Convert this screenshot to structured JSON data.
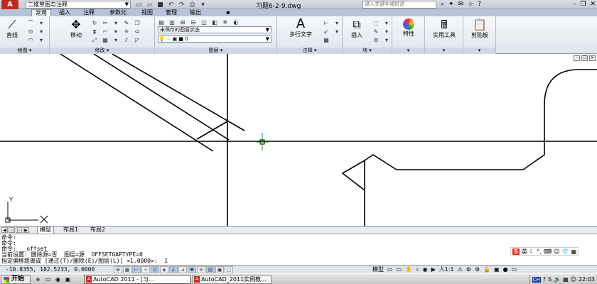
{
  "titlebar": {
    "app_logo": "A",
    "workspace": "二维草图与注释",
    "doc_title": "习题6-2-9.dwg",
    "search_placeholder": "键入关键字或短语"
  },
  "tabs": [
    "常用",
    "插入",
    "注释",
    "参数化",
    "视图",
    "管理",
    "输出"
  ],
  "ribbon": {
    "draw": {
      "line_label": "直线",
      "panel_title": "绘图"
    },
    "modify": {
      "move_label": "移动",
      "panel_title": "修改"
    },
    "layers": {
      "state": "未保存的图层状态",
      "current_layer": "0",
      "panel_title": "图层"
    },
    "annotation": {
      "mtext_label": "多行文字",
      "panel_title": "注释"
    },
    "block": {
      "insert_label": "插入",
      "panel_title": "块"
    },
    "properties": {
      "label": "特性"
    },
    "utilities": {
      "label": "实用工具"
    },
    "clipboard": {
      "label": "剪贴板"
    }
  },
  "canvas": {
    "ucs_x": "X",
    "ucs_y": "Y"
  },
  "layout_tabs": [
    "模型",
    "布局1",
    "布局2"
  ],
  "command": {
    "lines": [
      "命令:",
      "命令:",
      "命令:  _offset",
      "当前设置: 删除源=否  图层=源  OFFSETGAPTYPE=0",
      "指定偏移距离或 [通过(T)/删除(E)/图层(L)] <1.0000>:  1"
    ],
    "ime_label": "英"
  },
  "status": {
    "coords": "-10.8355, 182.5233, 0.0000",
    "model_label": "模型",
    "scale": "人1:1"
  },
  "taskbar": {
    "start": "开始",
    "tasks": [
      "AutoCAD 2011 - [习...",
      "AutoCAD_2011实例教..."
    ],
    "input_lang": "CH",
    "time": "22:03"
  },
  "colors": {
    "accent": "#c0281e",
    "ribbon_bg": "#dfe5ee",
    "cursor": "#18a018"
  }
}
